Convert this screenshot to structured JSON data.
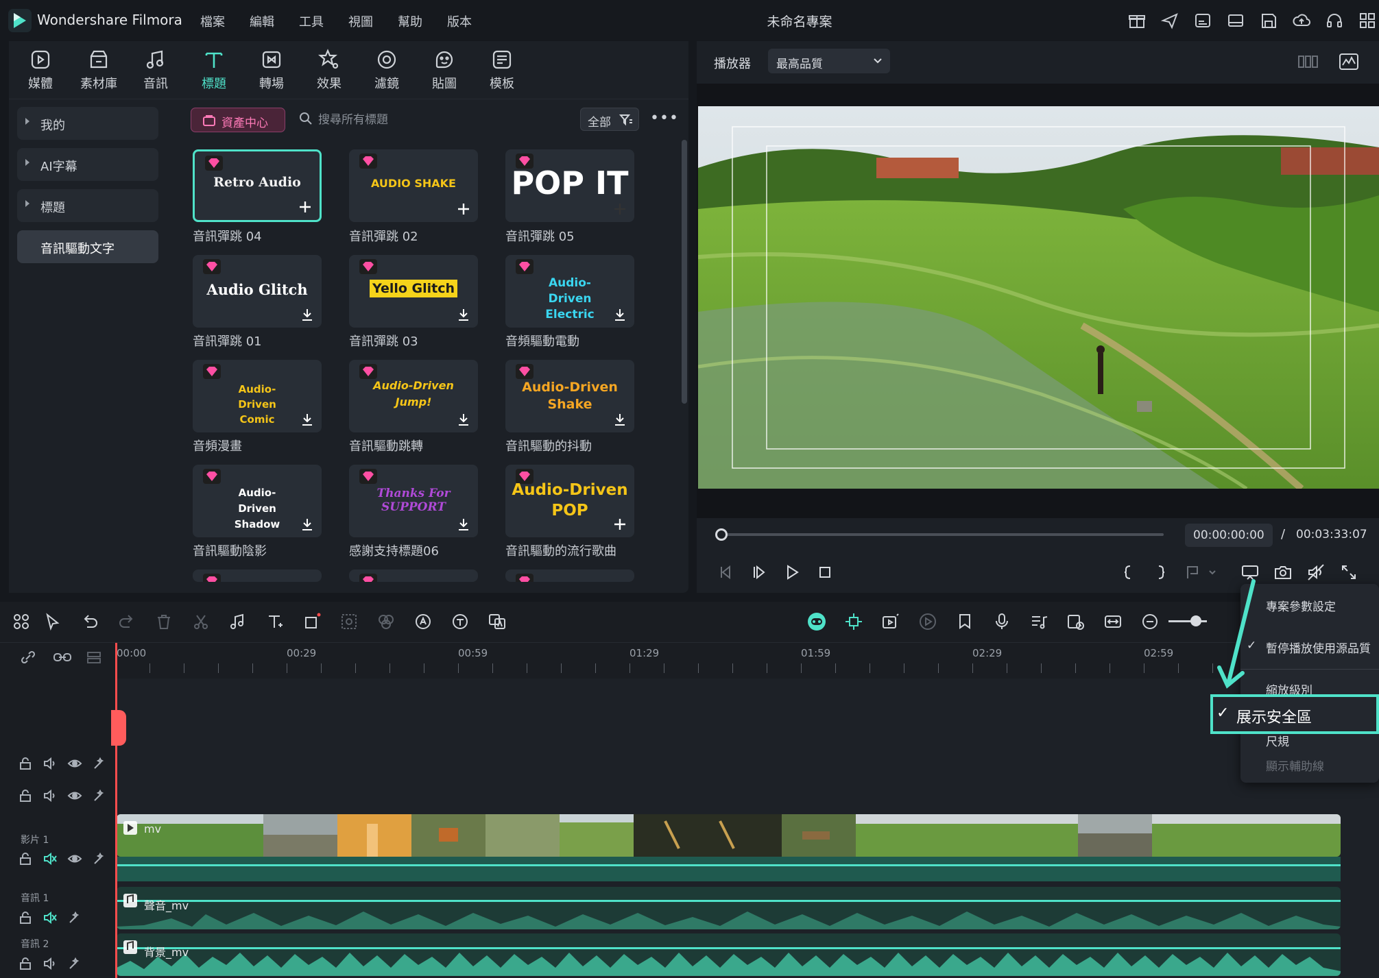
{
  "app": {
    "name": "Wondershare Filmora",
    "project_title": "未命名專案",
    "menu": [
      "檔案",
      "編輯",
      "工具",
      "視圖",
      "幫助",
      "版本"
    ],
    "accent": "#4fe2c9"
  },
  "media_toolbar": {
    "items": [
      {
        "label": "媒體",
        "icon": "media-icon"
      },
      {
        "label": "素材庫",
        "icon": "stock-icon"
      },
      {
        "label": "音訊",
        "icon": "music-icon"
      },
      {
        "label": "標題",
        "icon": "title-icon",
        "active": true
      },
      {
        "label": "轉場",
        "icon": "transition-icon"
      },
      {
        "label": "效果",
        "icon": "effects-icon"
      },
      {
        "label": "濾鏡",
        "icon": "filter-icon"
      },
      {
        "label": "貼圖",
        "icon": "sticker-icon"
      },
      {
        "label": "模板",
        "icon": "template-icon"
      }
    ]
  },
  "categories": [
    {
      "label": "我的",
      "expandable": true
    },
    {
      "label": "AI字幕",
      "expandable": true
    },
    {
      "label": "標題",
      "expandable": true
    },
    {
      "label": "音訊驅動文字",
      "active": true
    }
  ],
  "library": {
    "asset_center": "資產中心",
    "search_placeholder": "搜尋所有標題",
    "filter_label": "全部"
  },
  "titles": [
    {
      "preview": "Retro Audio",
      "label": "音訊彈跳 04",
      "action": "add",
      "selected": true
    },
    {
      "preview": "AUDIO SHAKE",
      "label": "音訊彈跳 02",
      "action": "add"
    },
    {
      "preview": "POP IT",
      "label": "音訊彈跳 05",
      "action": "add"
    },
    {
      "preview": "Audio Glitch",
      "label": "音訊彈跳 01",
      "action": "download"
    },
    {
      "preview": "Yello Glitch",
      "label": "音訊彈跳 03",
      "action": "download"
    },
    {
      "preview": "Audio-Driven Electric",
      "label": "音頻驅動電動",
      "action": "download"
    },
    {
      "preview": "Audio-Driven Comic",
      "label": "音頻漫畫",
      "action": "download"
    },
    {
      "preview": "Audio-Driven Jump!",
      "label": "音訊驅動跳轉",
      "action": "download"
    },
    {
      "preview": "Audio-Driven Shake",
      "label": "音訊驅動的抖動",
      "action": "download"
    },
    {
      "preview": "Audio-Driven Shadow",
      "label": "音訊驅動陰影",
      "action": "download"
    },
    {
      "preview": "Thanks For SUPPORT",
      "label": "感謝支持標題06",
      "action": "download"
    },
    {
      "preview": "Audio-Driven POP",
      "label": "音訊驅動的流行歌曲",
      "action": "add"
    }
  ],
  "player": {
    "label": "播放器",
    "quality": "最高品質",
    "current_time": "00:00:00:00",
    "separator": "/",
    "total_time": "00:03:33:07",
    "progress": 0
  },
  "timeline": {
    "ruler_labels": [
      "00:00",
      "00:29",
      "00:59",
      "01:29",
      "01:59",
      "02:29",
      "02:59"
    ],
    "tracks": [
      {
        "name": "影片 1"
      },
      {
        "name": "音訊 1"
      },
      {
        "name": "音訊 2"
      }
    ],
    "video_clip": "mv",
    "audio1_clip": "聲音_mv",
    "audio2_clip": "背景_mv"
  },
  "context_menu": {
    "items": [
      {
        "label": "專案參數設定"
      },
      {
        "label": "暫停播放使用源品質",
        "checked": true
      },
      {
        "label": "縮放級別"
      },
      {
        "label": "展示安全區",
        "checked": true,
        "highlighted": true
      },
      {
        "label": "尺規"
      },
      {
        "label": "顯示輔助線",
        "disabled": true
      }
    ]
  }
}
